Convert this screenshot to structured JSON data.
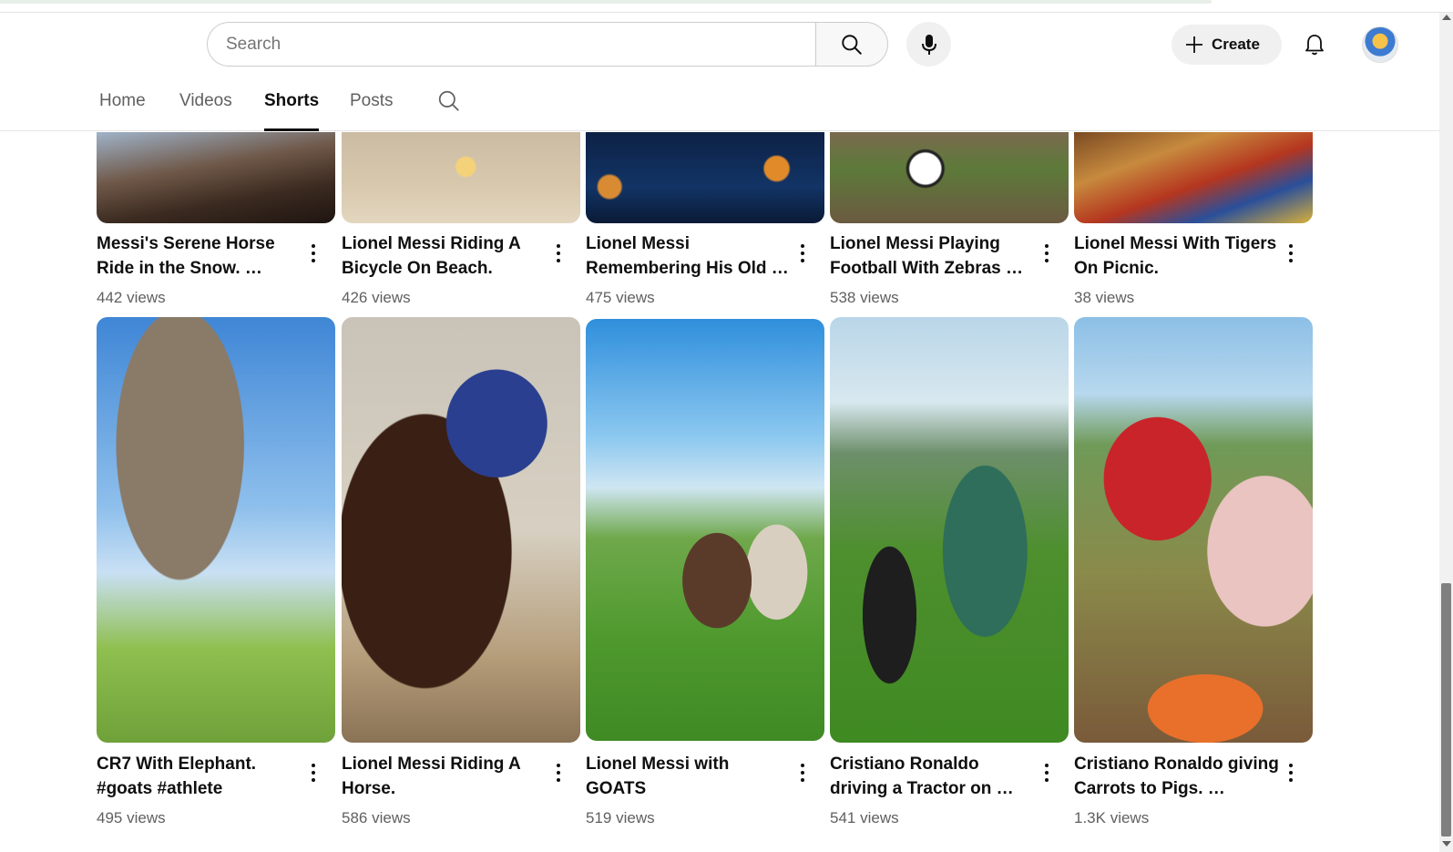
{
  "search": {
    "placeholder": "Search"
  },
  "header": {
    "create_label": "Create"
  },
  "tabs": [
    {
      "label": "Home"
    },
    {
      "label": "Videos"
    },
    {
      "label": "Shorts",
      "active": true
    },
    {
      "label": "Posts"
    }
  ],
  "row1": [
    {
      "title": "Messi's Serene Horse Ride in the Snow. …",
      "views": "442 views"
    },
    {
      "title": "Lionel Messi Riding A Bicycle On Beach.",
      "views": "426 views"
    },
    {
      "title": "Lionel Messi Remembering His Old …",
      "views": "475 views"
    },
    {
      "title": "Lionel Messi Playing Football With Zebras …",
      "views": "538 views"
    },
    {
      "title": "Lionel Messi With Tigers On Picnic.",
      "views": "38 views"
    }
  ],
  "row2": [
    {
      "title": "CR7 With Elephant. #goats #athlete",
      "views": "495 views"
    },
    {
      "title": "Lionel Messi Riding A Horse.",
      "views": "586 views"
    },
    {
      "title": "Lionel Messi with GOATS",
      "views": "519 views"
    },
    {
      "title": "Cristiano Ronaldo driving a Tractor on …",
      "views": "541 views"
    },
    {
      "title": "Cristiano Ronaldo giving Carrots to Pigs. …",
      "views": "1.3K views"
    }
  ]
}
